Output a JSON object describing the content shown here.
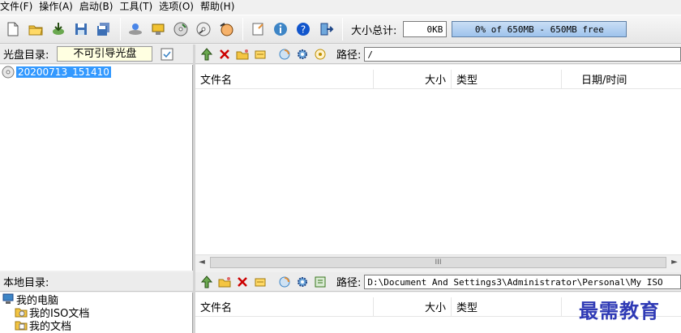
{
  "menu": [
    {
      "label": "文件(F)"
    },
    {
      "label": "操作(A)"
    },
    {
      "label": "启动(B)"
    },
    {
      "label": "工具(T)"
    },
    {
      "label": "选项(O)"
    },
    {
      "label": "帮助(H)"
    }
  ],
  "toolbar": {
    "total_size_label": "大小总计:",
    "total_size_value": "0KB",
    "capacity_text": "0% of 650MB - 650MB free",
    "capacity_fraction": 0.0
  },
  "disc_panel": {
    "label": "光盘目录:",
    "boot_status": "不可引导光盘",
    "tree": [
      {
        "label": "20200713_151410",
        "selected": true
      }
    ]
  },
  "disc_files": {
    "path_label": "路径:",
    "path": "/",
    "columns": [
      "文件名",
      "大小",
      "类型",
      "日期/时间"
    ],
    "rows": []
  },
  "scrollbar": {
    "grip": "III"
  },
  "local_panel": {
    "label": "本地目录:",
    "tree": [
      {
        "label": "我的电脑"
      },
      {
        "label": "我的ISO文档"
      },
      {
        "label": "我的文档"
      }
    ]
  },
  "local_files": {
    "path_label": "路径:",
    "path": "D:\\Document And Settings3\\Administrator\\Personal\\My ISO",
    "columns": [
      "文件名",
      "大小",
      "类型"
    ]
  },
  "watermark": "最需教育",
  "colors": {
    "accent": "#3399ff",
    "capacity_bar": "#9ec3ec",
    "watermark": "#2f3ab5"
  }
}
